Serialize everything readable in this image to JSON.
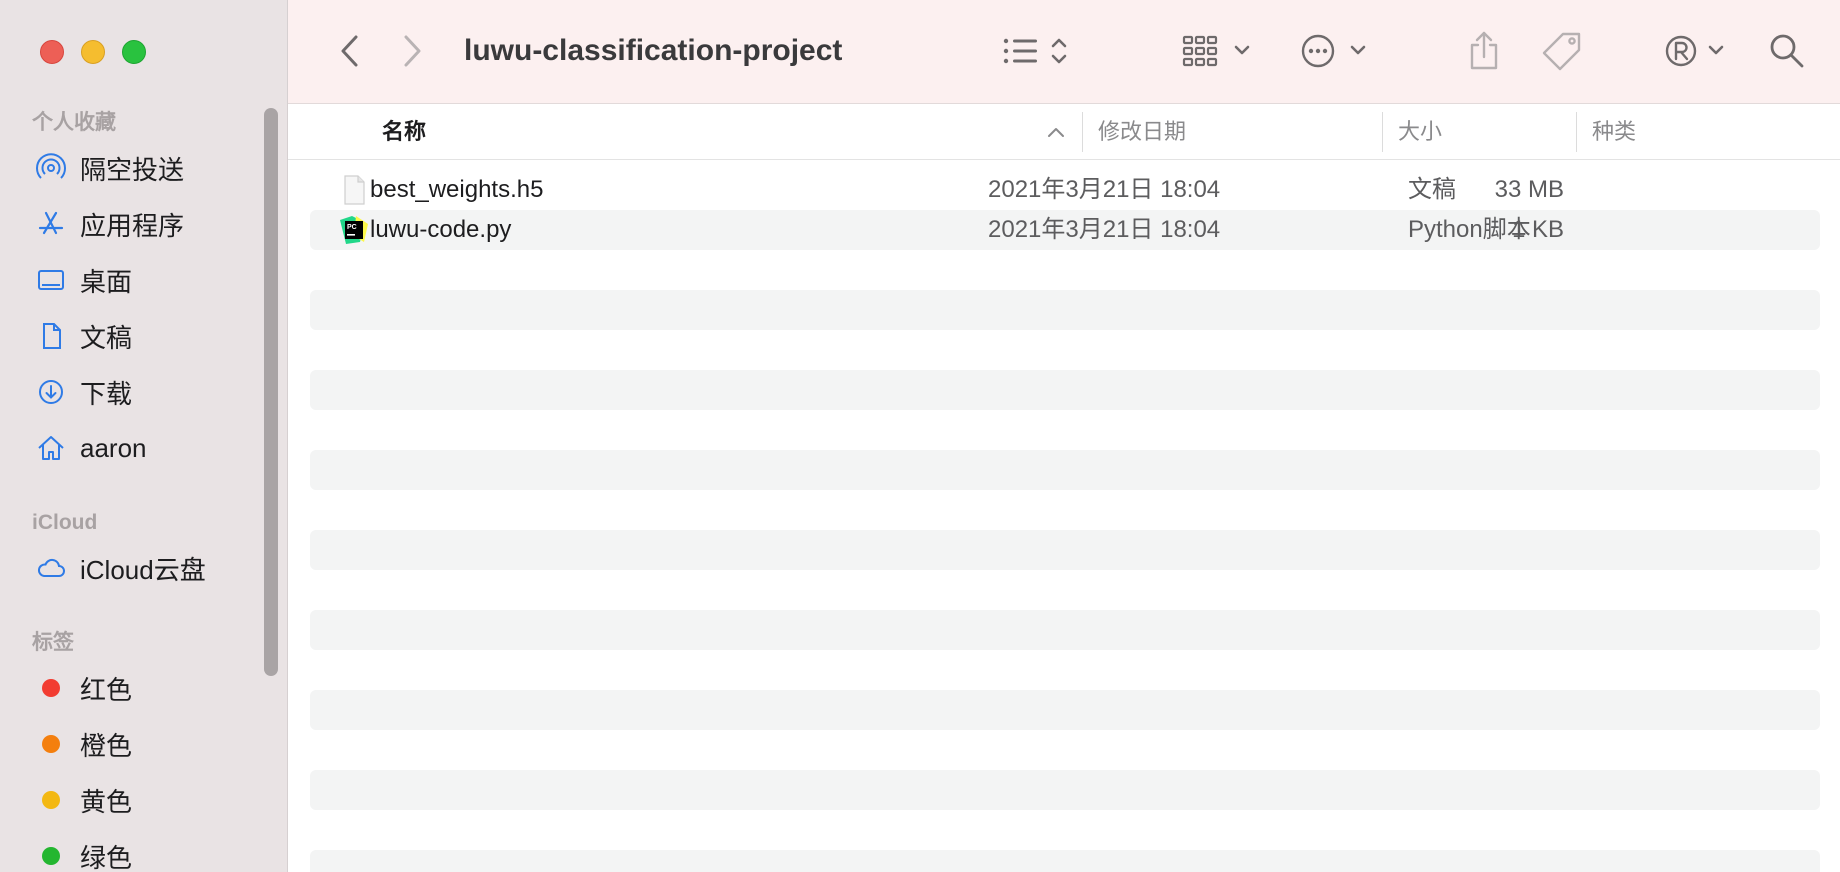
{
  "window": {
    "title": "luwu-classification-project"
  },
  "sidebar": {
    "favorites_heading": "个人收藏",
    "favorites": [
      {
        "label": "隔空投送",
        "icon": "airdrop-icon"
      },
      {
        "label": "应用程序",
        "icon": "applications-icon"
      },
      {
        "label": "桌面",
        "icon": "desktop-icon"
      },
      {
        "label": "文稿",
        "icon": "document-icon"
      },
      {
        "label": "下载",
        "icon": "download-icon"
      },
      {
        "label": "aaron",
        "icon": "home-icon"
      }
    ],
    "icloud_heading": "iCloud",
    "icloud": [
      {
        "label": "iCloud云盘",
        "icon": "cloud-icon"
      }
    ],
    "tags_heading": "标签",
    "tags": [
      {
        "label": "红色",
        "color": "#f23c31"
      },
      {
        "label": "橙色",
        "color": "#f47f0e"
      },
      {
        "label": "黄色",
        "color": "#f3b812"
      },
      {
        "label": "绿色",
        "color": "#24b630"
      }
    ]
  },
  "columns": {
    "name": "名称",
    "date": "修改日期",
    "size": "大小",
    "kind": "种类"
  },
  "files": [
    {
      "name": "best_weights.h5",
      "date": "2021年3月21日 18:04",
      "size": "33 MB",
      "kind": "文稿",
      "icon": "generic-file-icon"
    },
    {
      "name": "luwu-code.py",
      "date": "2021年3月21日 18:04",
      "size": "1 KB",
      "kind": "Python脚本",
      "icon": "pycharm-file-icon"
    }
  ],
  "colors": {
    "sidebar_bg": "#e9e3e4",
    "toolbar_bg": "#fcf0f0",
    "row_alt": "#f3f4f4"
  }
}
